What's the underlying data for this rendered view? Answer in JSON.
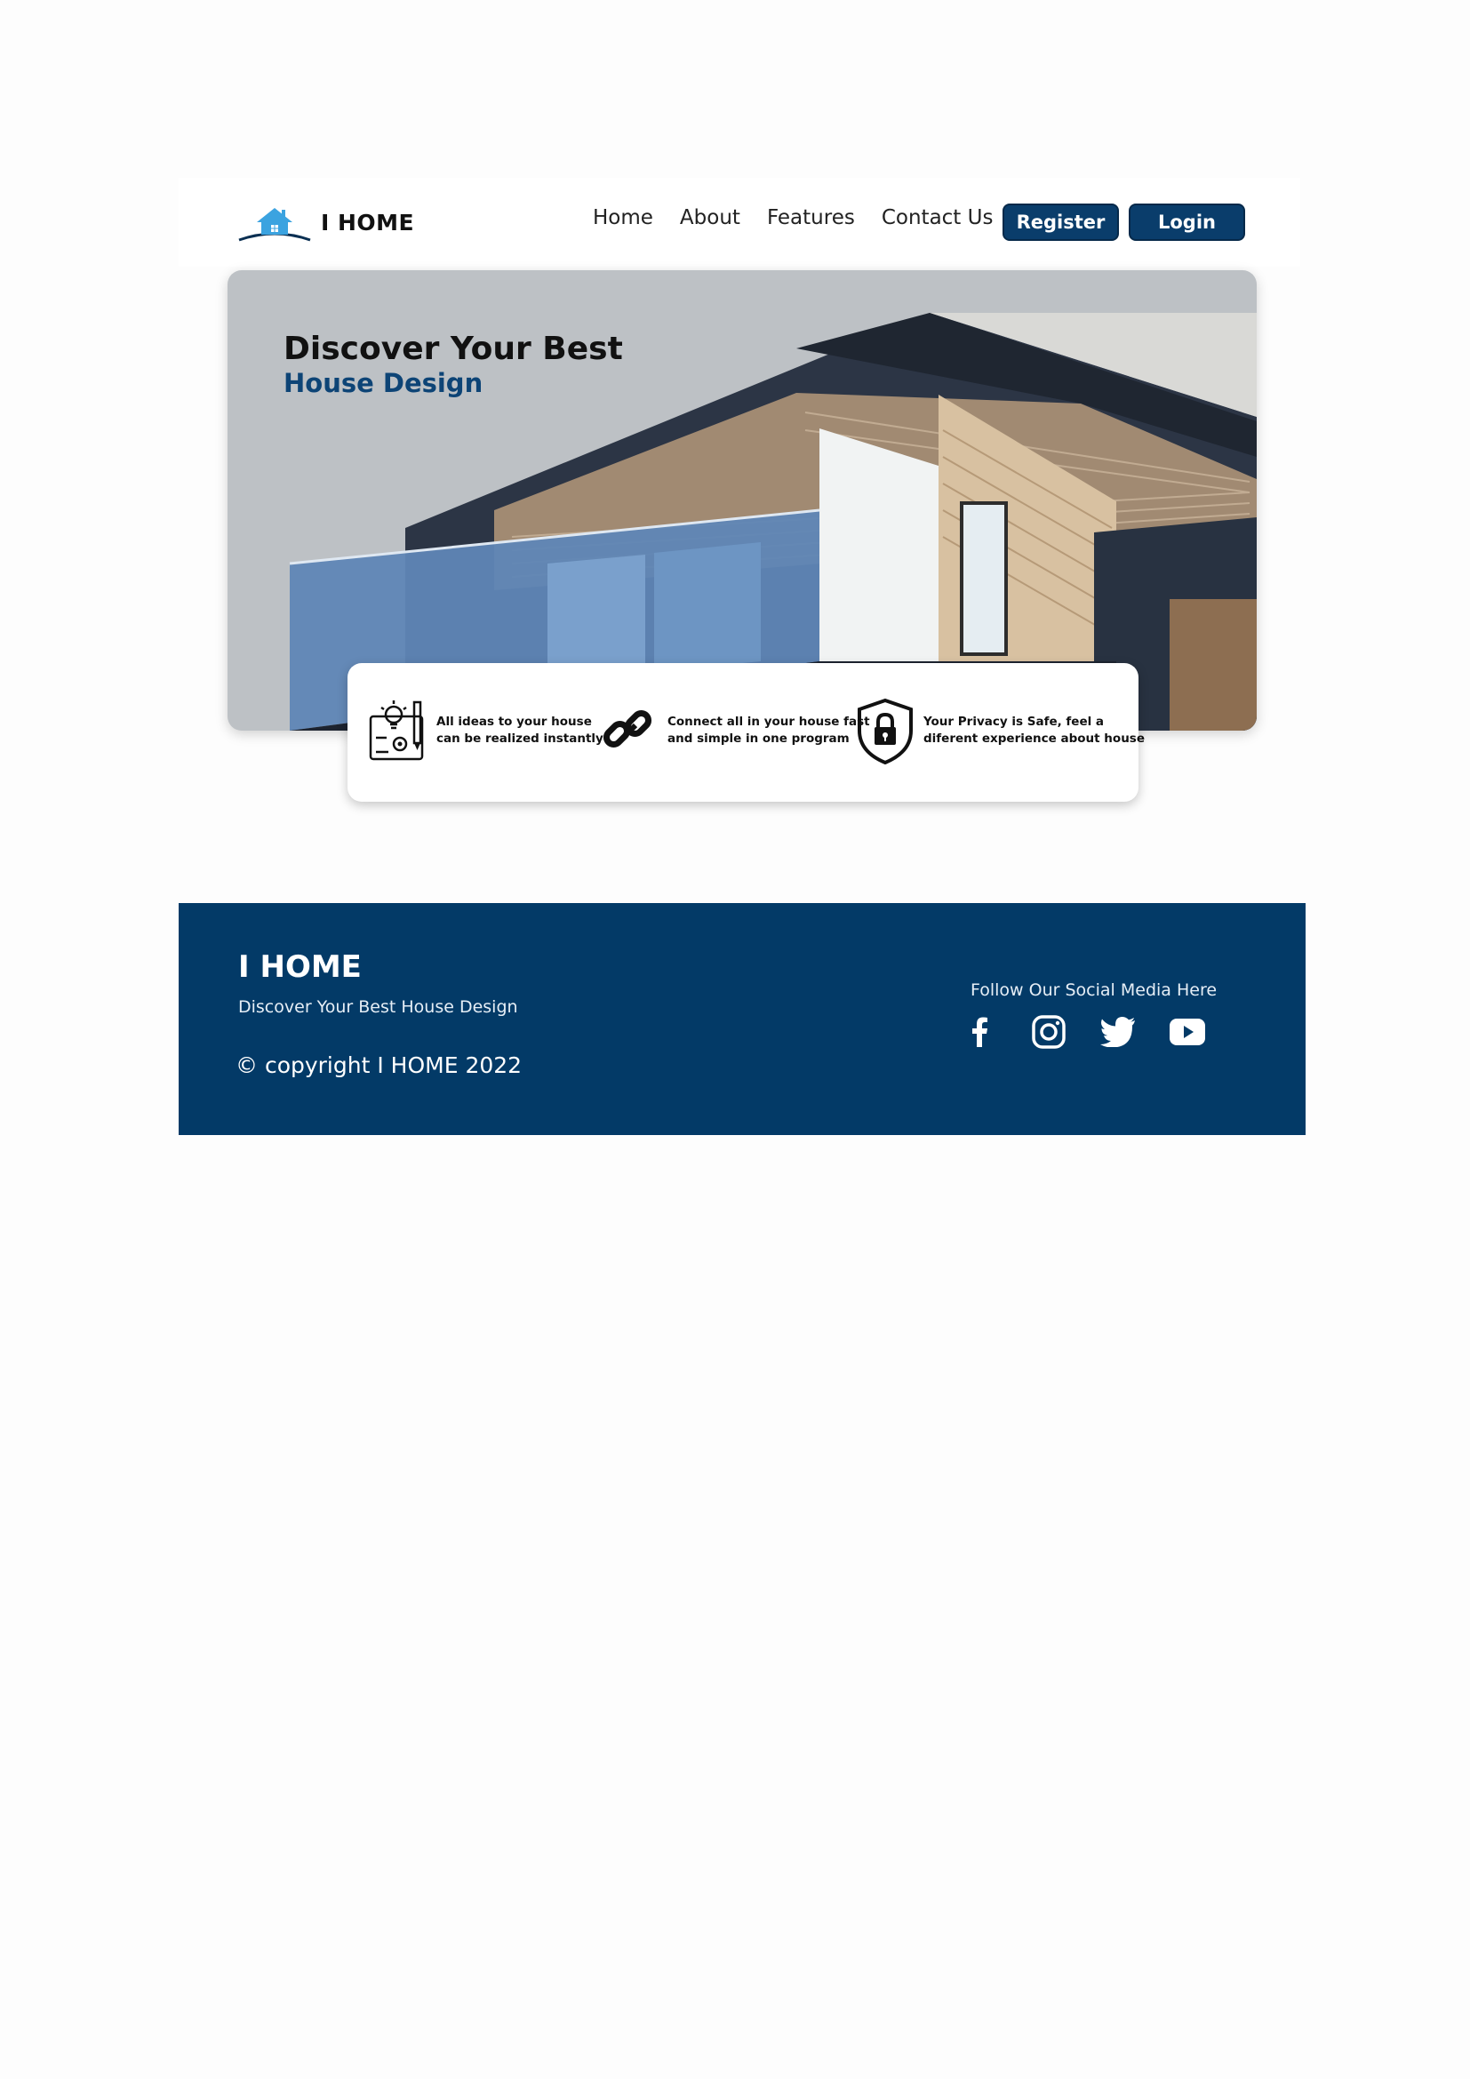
{
  "nav": {
    "brand": "I HOME",
    "links": [
      "Home",
      "About",
      "Features",
      "Contact Us"
    ],
    "register_label": "Register",
    "login_label": "Login"
  },
  "hero": {
    "title": "Discover Your Best",
    "subtitle": "House Design"
  },
  "features": [
    {
      "icon": "blueprint-icon",
      "line1": "All ideas to your house",
      "line2": "can be realized instantly"
    },
    {
      "icon": "link-icon",
      "line1": "Connect all in your house fast",
      "line2": "and simple in one program"
    },
    {
      "icon": "shield-lock-icon",
      "line1": "Your Privacy is Safe, feel a",
      "line2": "diferent experience about house"
    }
  ],
  "footer": {
    "brand": "I HOME",
    "tagline": "Discover Your Best House Design",
    "copyright": "© copyright I HOME 2022",
    "social_title": "Follow Our Social Media Here",
    "social_icons": [
      "facebook-icon",
      "instagram-icon",
      "twitter-icon",
      "youtube-icon"
    ]
  },
  "colors": {
    "brand_navy": "#033a67",
    "button_navy": "#0a3d6b",
    "subtitle_blue": "#0d4476",
    "logo_blue": "#3ba3e0",
    "hero_background": "#bdc1c5"
  }
}
